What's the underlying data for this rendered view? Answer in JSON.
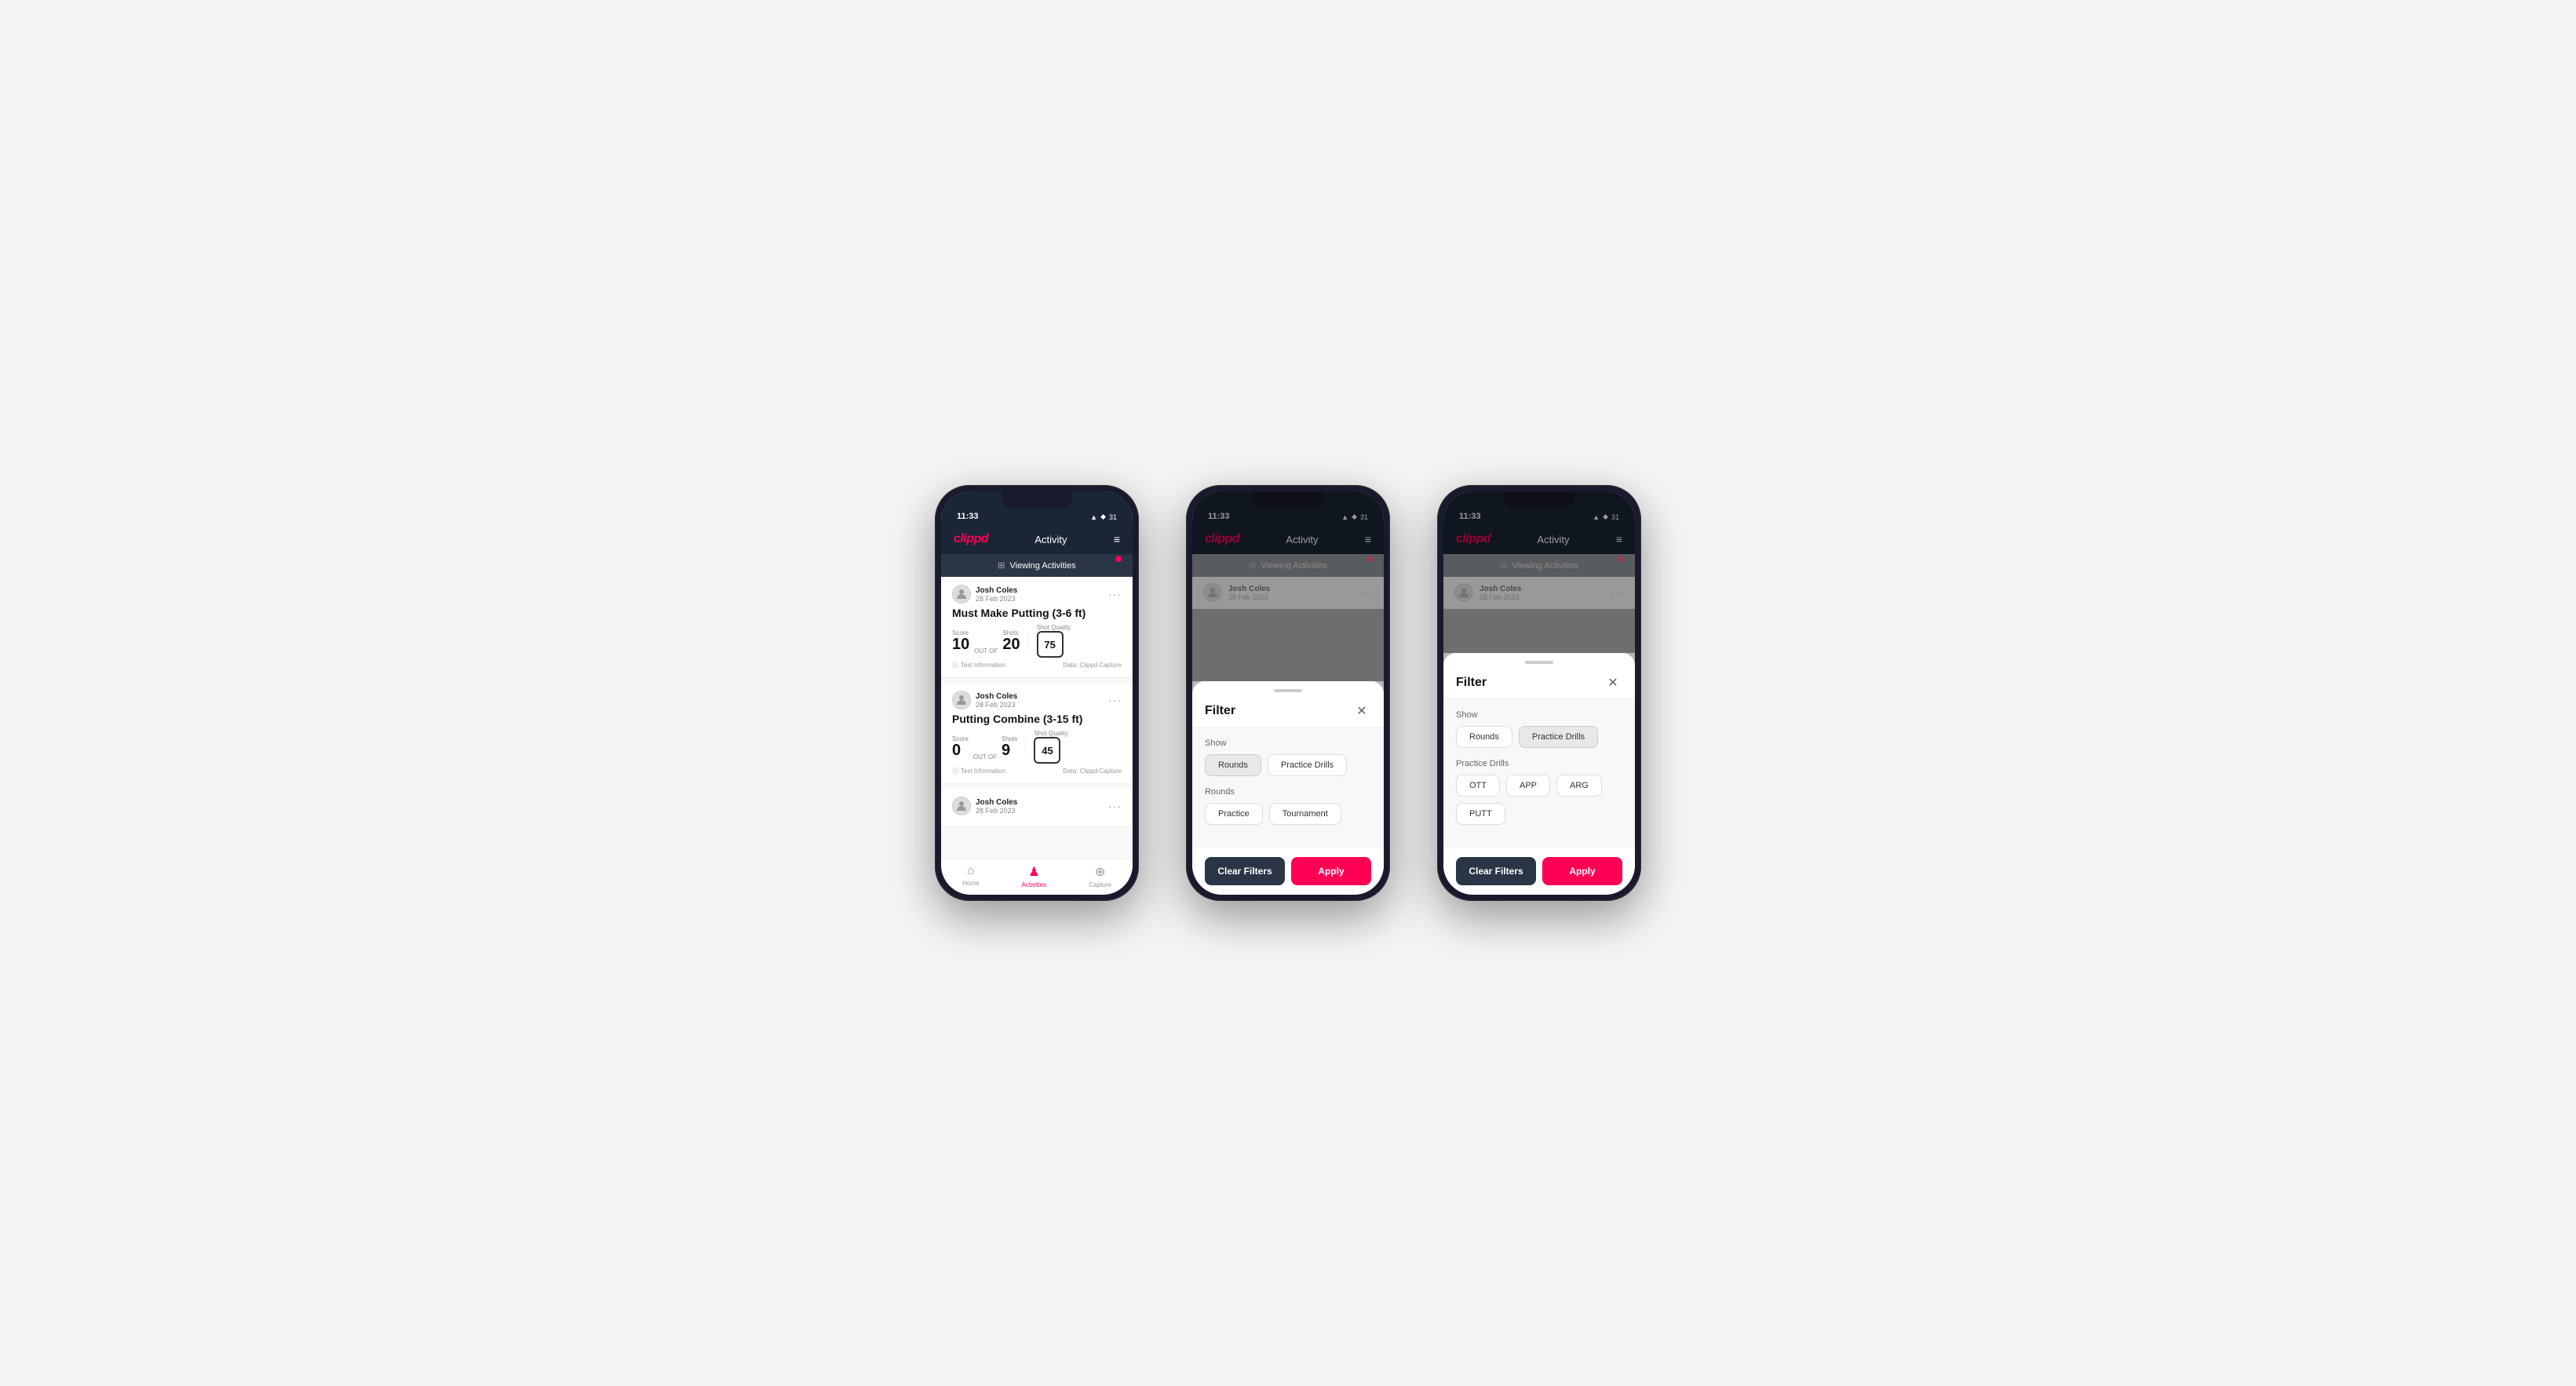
{
  "phones": [
    {
      "id": "phone1",
      "status": {
        "time": "11:33",
        "icons": "▲ ◆ 31"
      },
      "nav": {
        "logo": "clippd",
        "title": "Activity",
        "menu": "≡"
      },
      "viewing_bar": {
        "icon": "⊞",
        "text": "Viewing Activities"
      },
      "activities": [
        {
          "user_name": "Josh Coles",
          "user_date": "28 Feb 2023",
          "title": "Must Make Putting (3-6 ft)",
          "score_label": "Score",
          "score": "10",
          "out_of_label": "OUT OF",
          "shots_label": "Shots",
          "shots": "20",
          "shot_quality_label": "Shot Quality",
          "shot_quality": "75",
          "info": "Test Information",
          "data": "Data: Clippd Capture"
        },
        {
          "user_name": "Josh Coles",
          "user_date": "28 Feb 2023",
          "title": "Putting Combine (3-15 ft)",
          "score_label": "Score",
          "score": "0",
          "out_of_label": "OUT OF",
          "shots_label": "Shots",
          "shots": "9",
          "shot_quality_label": "Shot Quality",
          "shot_quality": "45",
          "info": "Test Information",
          "data": "Data: Clippd Capture"
        },
        {
          "user_name": "Josh Coles",
          "user_date": "28 Feb 2023",
          "title": "",
          "score_label": "",
          "score": "",
          "out_of_label": "",
          "shots_label": "",
          "shots": "",
          "shot_quality_label": "",
          "shot_quality": "",
          "info": "",
          "data": ""
        }
      ],
      "tabs": [
        {
          "label": "Home",
          "icon": "⌂",
          "active": false
        },
        {
          "label": "Activities",
          "icon": "♟",
          "active": true
        },
        {
          "label": "Capture",
          "icon": "⊕",
          "active": false
        }
      ],
      "show_filter": false
    },
    {
      "id": "phone2",
      "status": {
        "time": "11:33",
        "icons": "▲ ◆ 31"
      },
      "nav": {
        "logo": "clippd",
        "title": "Activity",
        "menu": "≡"
      },
      "viewing_bar": {
        "icon": "⊞",
        "text": "Viewing Activities"
      },
      "filter": {
        "title": "Filter",
        "show_section": "Show",
        "show_options": [
          {
            "label": "Rounds",
            "active": true
          },
          {
            "label": "Practice Drills",
            "active": false
          }
        ],
        "rounds_section": "Rounds",
        "rounds_options": [
          {
            "label": "Practice",
            "active": false
          },
          {
            "label": "Tournament",
            "active": false
          }
        ],
        "clear_label": "Clear Filters",
        "apply_label": "Apply"
      },
      "show_filter": true
    },
    {
      "id": "phone3",
      "status": {
        "time": "11:33",
        "icons": "▲ ◆ 31"
      },
      "nav": {
        "logo": "clippd",
        "title": "Activity",
        "menu": "≡"
      },
      "viewing_bar": {
        "icon": "⊞",
        "text": "Viewing Activities"
      },
      "filter": {
        "title": "Filter",
        "show_section": "Show",
        "show_options": [
          {
            "label": "Rounds",
            "active": false
          },
          {
            "label": "Practice Drills",
            "active": true
          }
        ],
        "drills_section": "Practice Drills",
        "drills_options": [
          {
            "label": "OTT",
            "active": false
          },
          {
            "label": "APP",
            "active": false
          },
          {
            "label": "ARG",
            "active": false
          },
          {
            "label": "PUTT",
            "active": false
          }
        ],
        "clear_label": "Clear Filters",
        "apply_label": "Apply"
      },
      "show_filter": true
    }
  ]
}
